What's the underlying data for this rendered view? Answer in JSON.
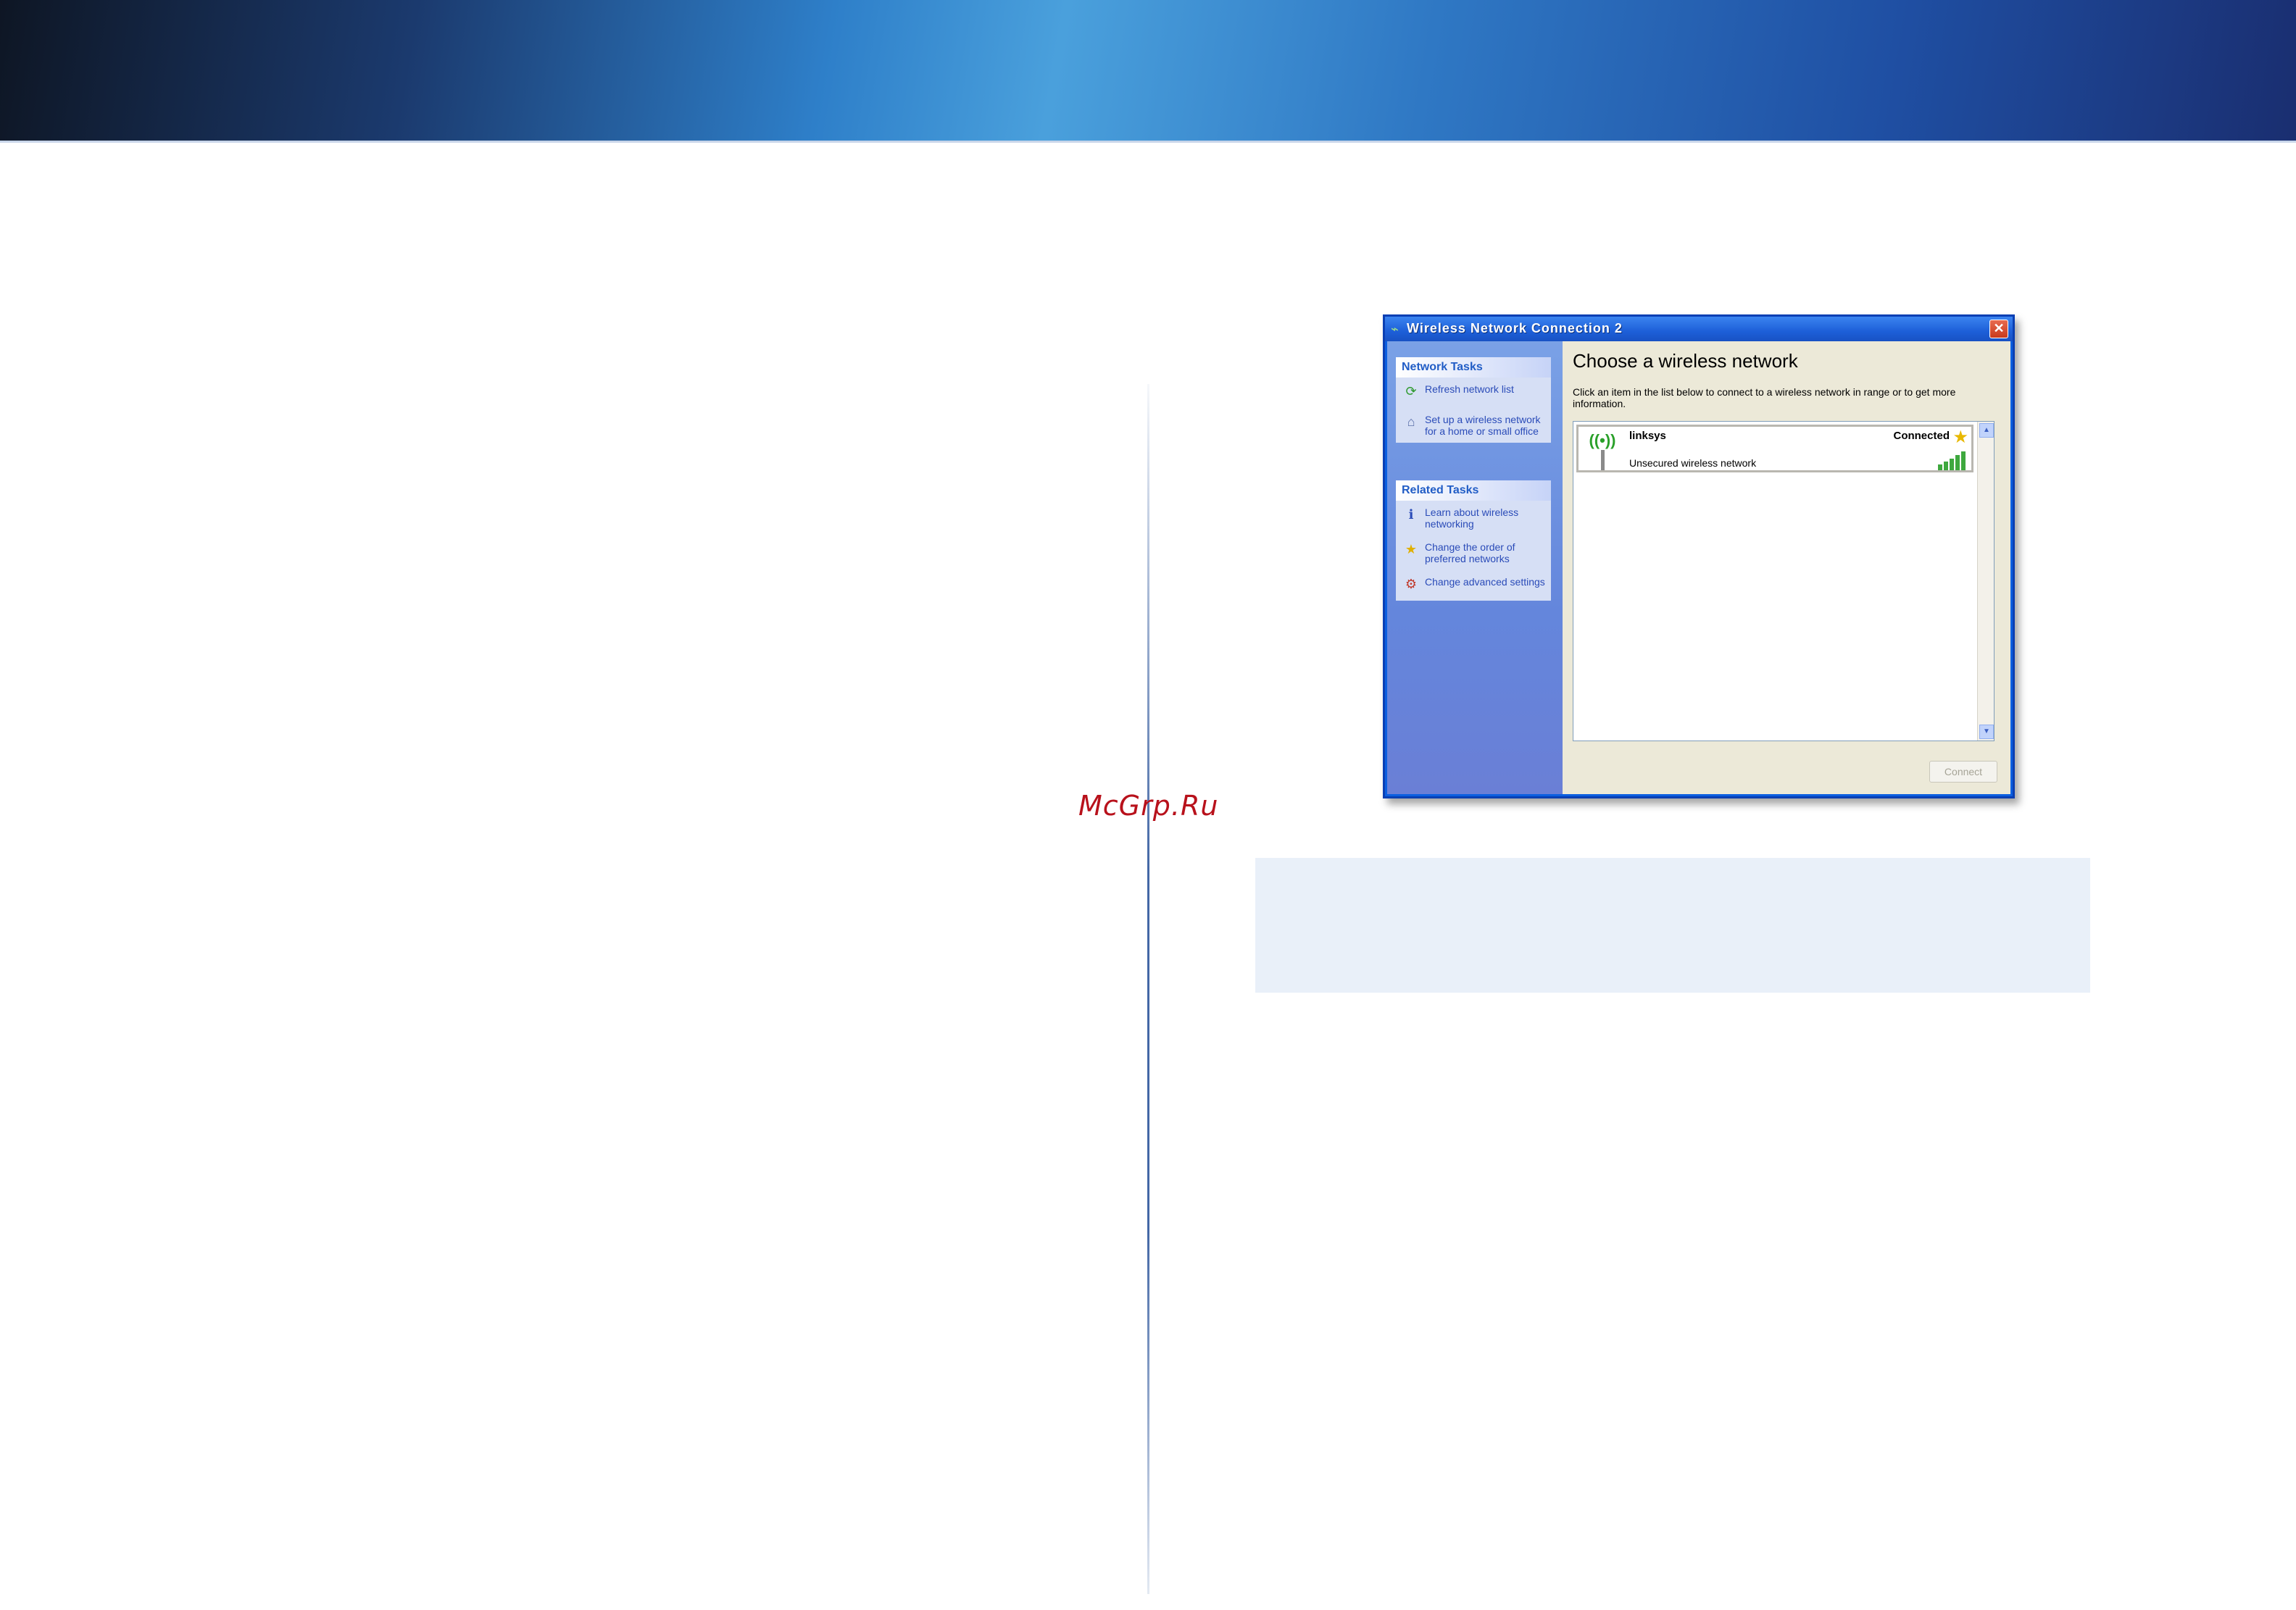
{
  "watermark": "McGrp.Ru",
  "window": {
    "title": "Wireless Network Connection 2",
    "close_label": "✕",
    "network_tasks": {
      "header": "Network Tasks",
      "items": [
        {
          "label": "Refresh network list",
          "icon": "refresh-icon"
        },
        {
          "label": "Set up a wireless network for a home or small office",
          "icon": "setup-network-icon"
        }
      ]
    },
    "related_tasks": {
      "header": "Related Tasks",
      "items": [
        {
          "label": "Learn about wireless networking",
          "icon": "info-icon"
        },
        {
          "label": "Change the order of preferred networks",
          "icon": "star-icon"
        },
        {
          "label": "Change advanced settings",
          "icon": "settings-icon"
        }
      ]
    },
    "main": {
      "heading": "Choose a wireless network",
      "instruction": "Click an item in the list below to connect to a wireless network in range or to get more information.",
      "networks": [
        {
          "name": "linksys",
          "description": "Unsecured wireless network",
          "status": "Connected",
          "signal_bars": 5
        }
      ],
      "connect_label": "Connect"
    }
  },
  "colors": {
    "banner_accent": "#2e7fc9",
    "xp_titlebar": "#1d5fd8",
    "watermark": "#b8111b",
    "note_box": "#e9f0f9"
  }
}
